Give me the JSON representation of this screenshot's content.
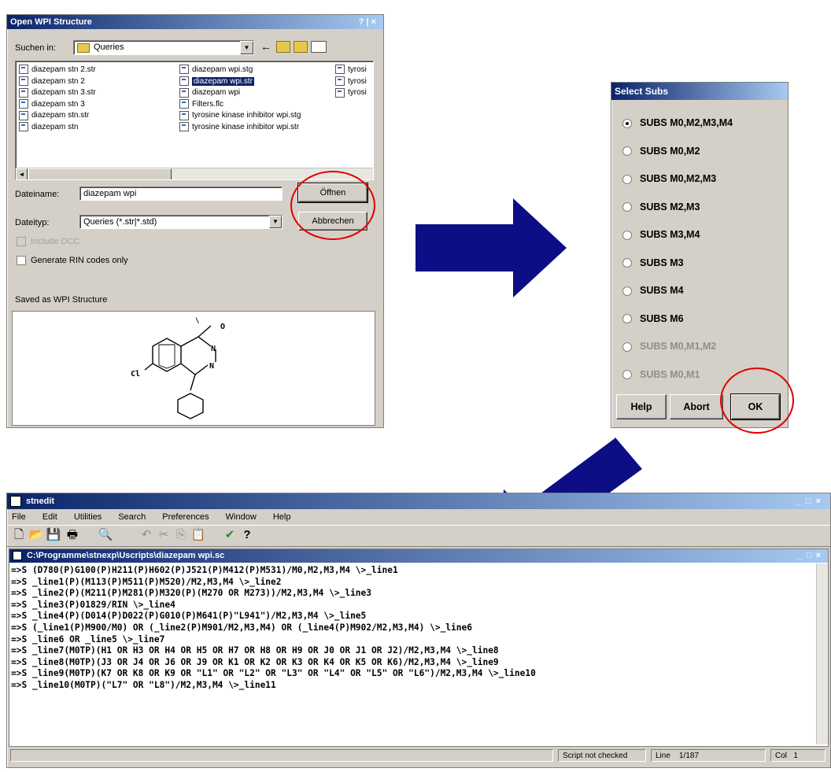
{
  "colors": {
    "accent_red": "#e00000",
    "arrow_blue": "#0d0d86",
    "titlebar": "#0a246a"
  },
  "open_dialog": {
    "title": "Open WPI Structure",
    "title_buttons": "?|×",
    "look_in_label": "Suchen in:",
    "look_in_value": "Queries",
    "files_col1": [
      "diazepam stn 2.str",
      "diazepam stn 2",
      "diazepam stn 3.str",
      "diazepam stn 3",
      "diazepam stn.str",
      "diazepam stn"
    ],
    "files_col2": [
      "diazepam wpi.stg",
      "diazepam wpi.str",
      "diazepam wpi",
      "Filters.flc",
      "tyrosine kinase inhibitor wpi.stg",
      "tyrosine kinase inhibitor wpi.str"
    ],
    "files_col3": [
      "tyrosi",
      "tyrosi",
      "tyrosi"
    ],
    "filename_label": "Dateiname:",
    "filename_value": "diazepam wpi",
    "filetype_label": "Dateityp:",
    "filetype_value": "Queries (*.str|*.std)",
    "open_button": "Öffnen",
    "cancel_button": "Abbrechen",
    "include_dcc": "Include DCC",
    "generate_rin": "Generate RIN codes only",
    "saved_label": "Saved as WPI Structure",
    "mol_labels": {
      "o": "O",
      "n1": "N",
      "n2": "N",
      "cl": "Cl"
    }
  },
  "select_subs": {
    "title": "Select Subs",
    "options": [
      {
        "label": "SUBS M0,M2,M3,M4",
        "selected": true,
        "enabled": true
      },
      {
        "label": "SUBS M0,M2",
        "selected": false,
        "enabled": true
      },
      {
        "label": "SUBS M0,M2,M3",
        "selected": false,
        "enabled": true
      },
      {
        "label": "SUBS M2,M3",
        "selected": false,
        "enabled": true
      },
      {
        "label": "SUBS M3,M4",
        "selected": false,
        "enabled": true
      },
      {
        "label": "SUBS M3",
        "selected": false,
        "enabled": true
      },
      {
        "label": "SUBS M4",
        "selected": false,
        "enabled": true
      },
      {
        "label": "SUBS M6",
        "selected": false,
        "enabled": true
      },
      {
        "label": "SUBS M0,M1,M2",
        "selected": false,
        "enabled": false
      },
      {
        "label": "SUBS M0,M1",
        "selected": false,
        "enabled": false
      }
    ],
    "help_button": "Help",
    "abort_button": "Abort",
    "ok_button": "OK"
  },
  "stnedit": {
    "title": "stnedit",
    "title_buttons": "_□×",
    "menu": [
      "File",
      "Edit",
      "Utilities",
      "Search",
      "Preferences",
      "Window",
      "Help"
    ],
    "toolbar": {
      "new": "🗋",
      "open": "📂",
      "save": "💾",
      "print": "🖶",
      "find": "🔍",
      "undo": "↶",
      "cut": "✂",
      "copy": "⎘",
      "paste": "📋",
      "check": "✔",
      "help": "?"
    },
    "doc_title": "C:\\Programme\\stnexp\\Uscripts\\diazepam wpi.sc",
    "doc_buttons": "_□×",
    "lines": [
      "=>S (D780(P)G100(P)H211(P)H602(P)J521(P)M412(P)M531)/M0,M2,M3,M4 \\>_line1",
      "=>S _line1(P)(M113(P)M511(P)M520)/M2,M3,M4 \\>_line2",
      "=>S _line2(P)(M211(P)M281(P)M320(P)(M270 OR M273))/M2,M3,M4 \\>_line3",
      "=>S _line3(P)01829/RIN \\>_line4",
      "=>S _line4(P)(D014(P)D022(P)G010(P)M641(P)\"L941\")/M2,M3,M4 \\>_line5",
      "=>S (_line1(P)M900/M0) OR (_line2(P)M901/M2,M3,M4) OR (_line4(P)M902/M2,M3,M4) \\>_line6",
      "=>S _line6 OR _line5 \\>_line7",
      "=>S _line7(M0TP)(H1 OR H3 OR H4 OR H5 OR H7 OR H8 OR H9 OR J0 OR J1 OR J2)/M2,M3,M4 \\>_line8",
      "=>S _line8(M0TP)(J3 OR J4 OR J6 OR J9 OR K1 OR K2 OR K3 OR K4 OR K5 OR K6)/M2,M3,M4 \\>_line9",
      "=>S _line9(M0TP)(K7 OR K8 OR K9 OR \"L1\" OR \"L2\" OR \"L3\" OR \"L4\" OR \"L5\" OR \"L6\")/M2,M3,M4 \\>_line10",
      "=>S _line10(M0TP)(\"L7\" OR \"L8\")/M2,M3,M4 \\>_line11"
    ],
    "status": {
      "script": "Script not checked",
      "line_label": "Line",
      "line_value": "1/187",
      "col_label": "Col",
      "col_value": "1"
    }
  }
}
